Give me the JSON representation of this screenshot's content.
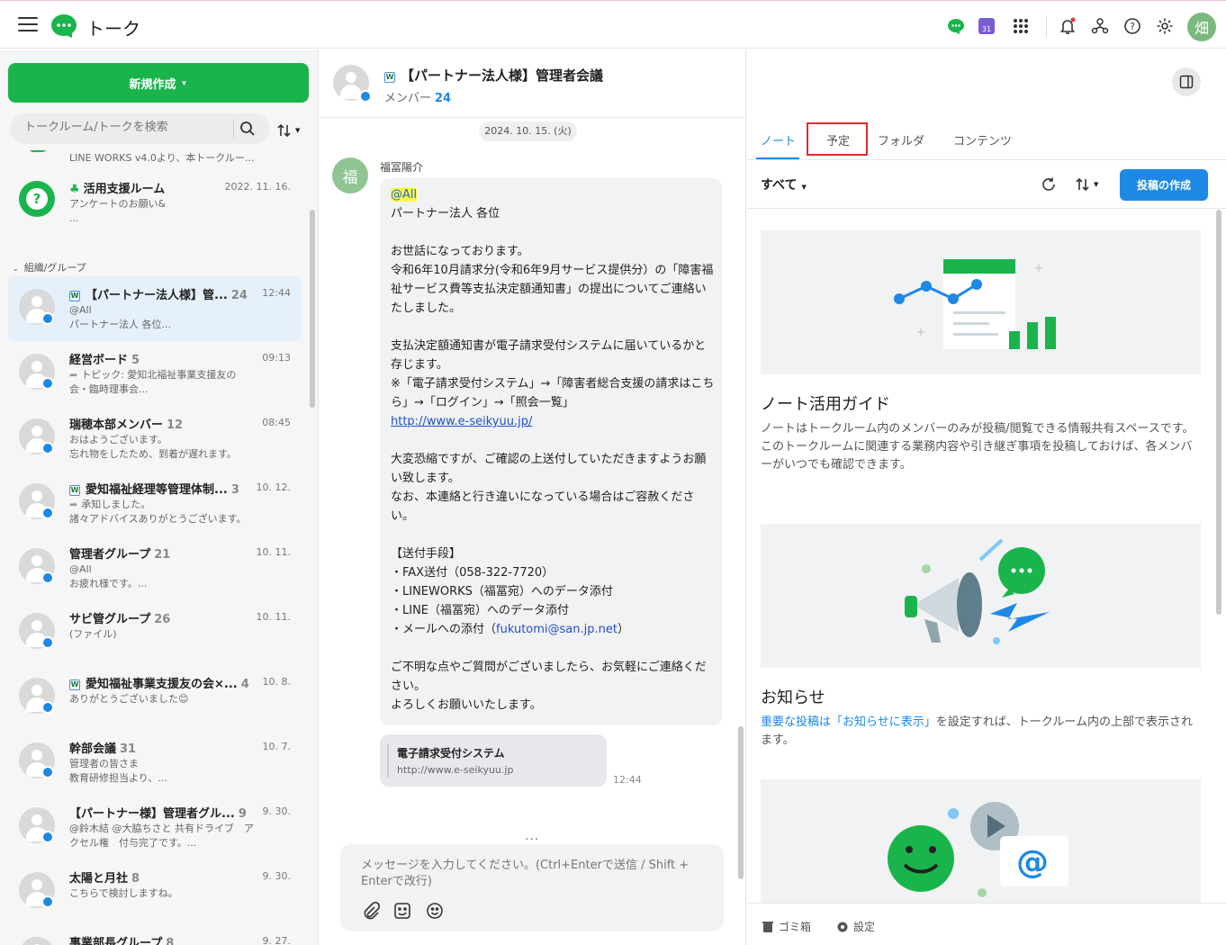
{
  "app": {
    "title": "トーク",
    "user_initial": "畑",
    "calendar_day": "31"
  },
  "sidebar": {
    "new_button": "新規作成",
    "search_placeholder": "トークルーム/トークを検索",
    "truncated_preview": "LINE WORKS v4.0より、本トークルー...",
    "support_room": {
      "name": "活用支援ルーム",
      "time": "2022. 11. 16.",
      "preview1": "アンケートのお願い&",
      "preview2": "..."
    },
    "section_label": "組織/グループ",
    "rooms": [
      {
        "name": "【パートナー法人様】管...",
        "count": "24",
        "time": "12:44",
        "line1": "@All",
        "line2": "パートナー法人 各位..."
      },
      {
        "name": "経営ボード",
        "count": "5",
        "time": "09:13",
        "line1": "トピック: 愛知北福祉事業支援友の",
        "line2": "会・臨時理事会..."
      },
      {
        "name": "瑞穂本部メンバー",
        "count": "12",
        "time": "08:45",
        "line1": "おはようございます。",
        "line2": "忘れ物をしたため、到着が遅れます。"
      },
      {
        "name": "愛知福祉経理等管理体制...",
        "count": "3",
        "time": "10. 12.",
        "line1": "承知しました。",
        "line2": "諸々アドバイスありがとうございます。"
      },
      {
        "name": "管理者グループ",
        "count": "21",
        "time": "10. 11.",
        "line1": "@All",
        "line2": "お疲れ様です。..."
      },
      {
        "name": "サビ管グループ",
        "count": "26",
        "time": "10. 11.",
        "line1": "(ファイル)",
        "line2": ""
      },
      {
        "name": "愛知福祉事業支援友の会×...",
        "count": "4",
        "time": "10. 8.",
        "line1": "ありがとうございました😊",
        "line2": ""
      },
      {
        "name": "幹部会議",
        "count": "31",
        "time": "10. 7.",
        "line1": "管理者の皆さま",
        "line2": "教育研修担当より、..."
      },
      {
        "name": "【パートナー様】管理者グル...",
        "count": "9",
        "time": "9. 30.",
        "line1": "@鈴木結 @大脇ちさと 共有ドライブ　ア",
        "line2": "クセル権　付与完了です。..."
      },
      {
        "name": "太陽と月社",
        "count": "8",
        "time": "9. 30.",
        "line1": "こちらで検討しますね。",
        "line2": ""
      },
      {
        "name": "事業部長グループ",
        "count": "8",
        "time": "9. 27.",
        "line1": "",
        "line2": ""
      }
    ]
  },
  "chat": {
    "title": "【パートナー法人様】管理者会議",
    "members_label": "メンバー",
    "members_count": "24",
    "date": "2024. 10. 15. (火)",
    "sender": "福冨陽介",
    "sender_initial": "福",
    "mention": "@All",
    "body1": "\nパートナー法人 各位\n\nお世話になっております。\n令和6年10月請求分(令和6年9月サービス提供分）の「障害福祉サービス費等支払決定額通知書」の提出についてご連絡いたしました。\n\n支払決定額通知書が電子請求受付システムに届いているかと存じます。\n※「電子請求受付システム」→「障害者総合支援の請求はこちら」→「ログイン」→「照会一覧」\n",
    "url": "http://www.e-seikyuu.jp/",
    "body2": "\n\n大変恐縮ですが、ご確認の上送付していただきますようお願い致します。\nなお、本連絡と行き違いになっている場合はご容赦ください。\n\n【送付手段】\n・FAX送付（058-322-7720）\n・LINEWORKS（福冨宛）へのデータ添付\n・LINE（福冨宛）へのデータ添付\n・メールへの添付（",
    "email": "fukutomi@san.jp.net",
    "body3": "）\n\nご不明な点やご質問がございましたら、お気軽にご連絡ください。\nよろしくお願いいたします。",
    "link_title": "電子請求受付システム",
    "link_url": "http://www.e-seikyuu.jp",
    "time": "12:44",
    "more": "...",
    "input_placeholder": "メッセージを入力してください。(Ctrl+Enterで送信 / Shift + Enterで改行)"
  },
  "panel": {
    "tabs": [
      "ノート",
      "予定",
      "フォルダ",
      "コンテンツ"
    ],
    "filter": "すべて",
    "post_button": "投稿の作成",
    "guide_title": "ノート活用ガイド",
    "guide_desc": "ノートはトークルーム内のメンバーのみが投稿/閲覧できる情報共有スペースです。\nこのトークルームに関連する業務内容や引き継ぎ事項を投稿しておけば、各メンバーがいつでも確認できます。",
    "notice_title": "お知らせ",
    "notice_link": "重要な投稿は「お知らせに表示」",
    "notice_desc": "を設定すれば、トークルーム内の上部で表示されます。",
    "trash": "ゴミ箱",
    "settings": "設定"
  },
  "colors": {
    "brand_green": "#19b54c",
    "accent_blue": "#1e88e5",
    "highlight_red": "#e02b2b"
  }
}
